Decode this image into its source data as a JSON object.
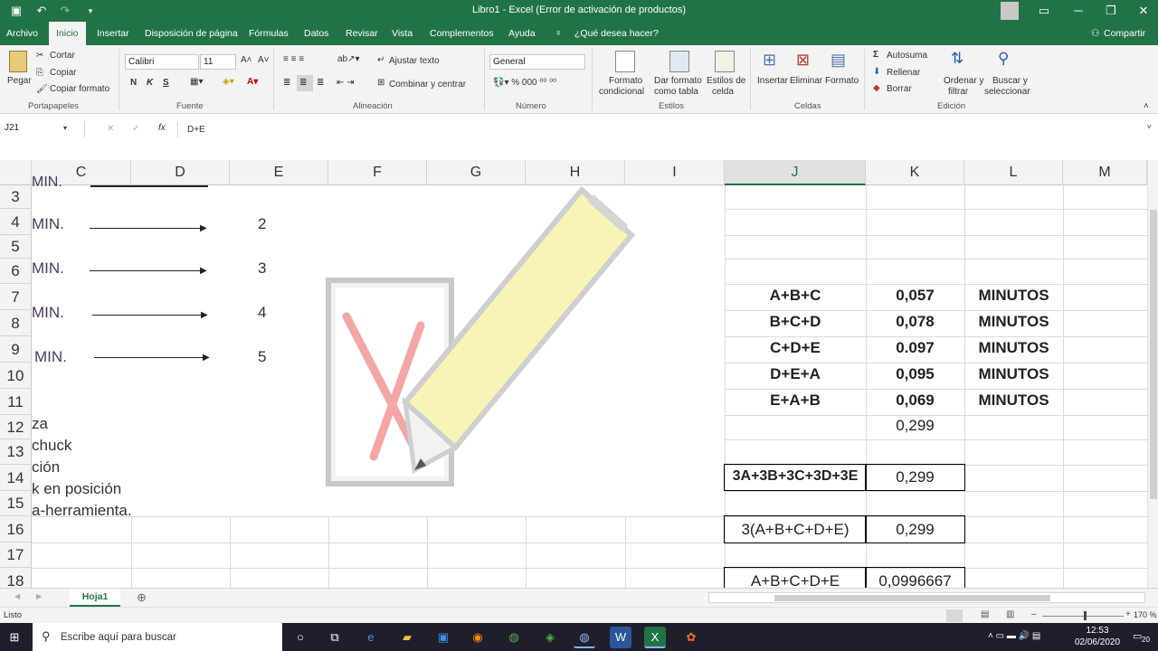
{
  "window": {
    "title": "Libro1  -  Excel (Error de activación de productos)"
  },
  "ribbon_tabs": [
    "Archivo",
    "Inicio",
    "Insertar",
    "Disposición de página",
    "Fórmulas",
    "Datos",
    "Revisar",
    "Vista",
    "Complementos",
    "Ayuda",
    "¿Qué desea hacer?"
  ],
  "share_label": "Compartir",
  "ribbon": {
    "paste": "Pegar",
    "cut": "Cortar",
    "copy": "Copiar",
    "format_painter": "Copiar formato",
    "clipboard_group": "Portapapeles",
    "font_name": "Calibri",
    "font_size": "11",
    "bold": "N",
    "italic": "K",
    "underline": "S",
    "font_group": "Fuente",
    "wrap_text": "Ajustar texto",
    "merge_center": "Combinar y centrar",
    "alignment_group": "Alineación",
    "number_format": "General",
    "number_group": "Número",
    "cond_format_1": "Formato",
    "cond_format_2": "condicional",
    "table_format_1": "Dar formato",
    "table_format_2": "como tabla",
    "cell_styles_1": "Estilos de",
    "cell_styles_2": "celda",
    "styles_group": "Estilos",
    "insert": "Insertar",
    "delete": "Eliminar",
    "format": "Formato",
    "cells_group": "Celdas",
    "autosum": "Autosuma",
    "fill": "Rellenar",
    "clear": "Borrar",
    "sort_1": "Ordenar y",
    "sort_2": "filtrar",
    "find_1": "Buscar y",
    "find_2": "seleccionar",
    "editing_group": "Edición"
  },
  "formula_bar": {
    "name_box": "J21",
    "formula": "D+E"
  },
  "columns": [
    "C",
    "D",
    "E",
    "F",
    "G",
    "H",
    "I",
    "J",
    "K",
    "L",
    "M"
  ],
  "rows": [
    "3",
    "4",
    "5",
    "6",
    "7",
    "8",
    "9",
    "10",
    "11",
    "12",
    "13",
    "14",
    "15",
    "16",
    "17",
    "18"
  ],
  "picture": {
    "top_fragment": "MIN.",
    "rows": [
      {
        "label": "MIN.",
        "num": "2"
      },
      {
        "label": "MIN.",
        "num": "3"
      },
      {
        "label": "MIN.",
        "num": "4"
      },
      {
        "label": " MIN.",
        "num": "5"
      }
    ],
    "list": [
      "za",
      "chuck",
      "ción",
      "k en posición",
      "a-herramienta."
    ]
  },
  "table": [
    {
      "label": "A+B+C",
      "value": "0,057",
      "unit": "MINUTOS"
    },
    {
      "label": "B+C+D",
      "value": "0,078",
      "unit": "MINUTOS"
    },
    {
      "label": "C+D+E",
      "value": "0.097",
      "unit": "MINUTOS"
    },
    {
      "label": "D+E+A",
      "value": "0,095",
      "unit": "MINUTOS"
    },
    {
      "label": "E+A+B",
      "value": "0,069",
      "unit": "MINUTOS"
    }
  ],
  "total_row12": "0,299",
  "boxes": [
    {
      "label": "3A+3B+3C+3D+3E",
      "value": "0,299"
    },
    {
      "label": "3(A+B+C+D+E)",
      "value": "0,299"
    },
    {
      "label": "A+B+C+D+E",
      "value": "0,0996667"
    }
  ],
  "sheet_tab": "Hoja1",
  "status": {
    "ready": "Listo",
    "zoom": "170 %"
  },
  "taskbar": {
    "search_placeholder": "Escribe aquí para buscar",
    "time": "12:53",
    "date": "02/06/2020",
    "notif_count": "20"
  }
}
